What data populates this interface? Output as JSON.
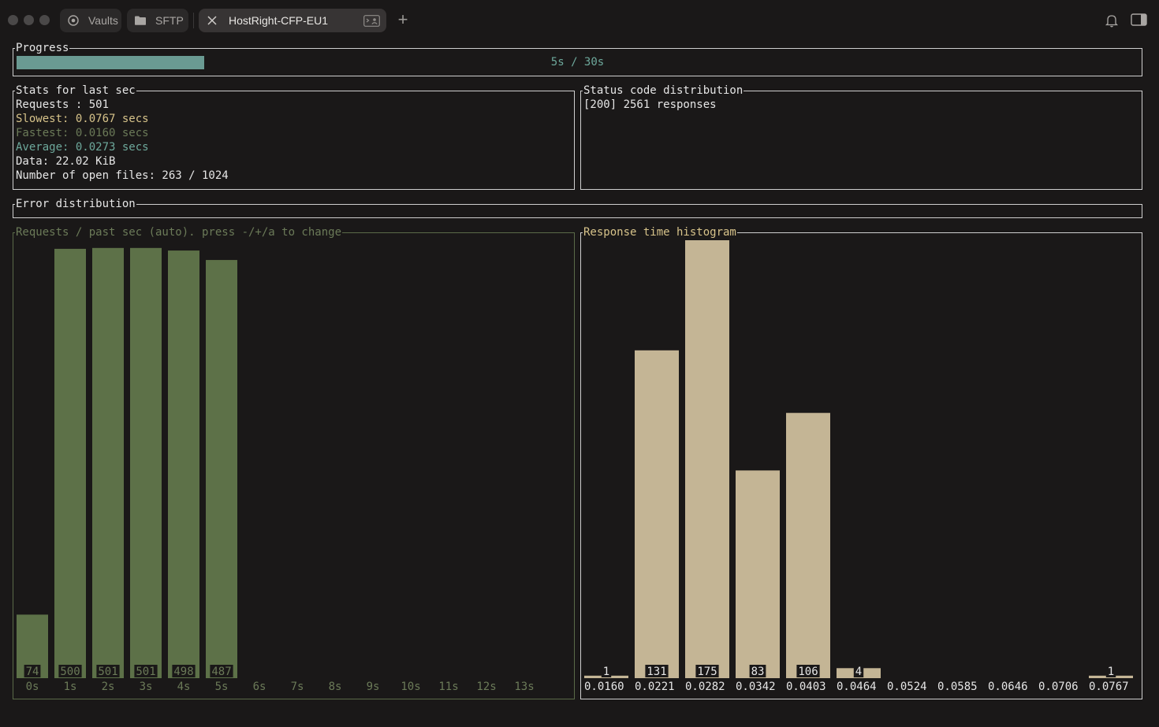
{
  "tabs": [
    {
      "label": "Vaults",
      "icon": "vault-icon"
    },
    {
      "label": "SFTP",
      "icon": "folder-icon"
    },
    {
      "label": "HostRight-CFP-EU1",
      "icon": "close-icon",
      "active": true
    }
  ],
  "progress": {
    "title": "Progress",
    "text": "5s / 30s",
    "fraction": 0.1667,
    "color": "#6a9a92"
  },
  "stats": {
    "title": "Stats for last sec",
    "requests": "Requests : 501",
    "slowest": "Slowest: 0.0767 secs",
    "fastest": "Fastest: 0.0160 secs",
    "average": "Average: 0.0273 secs",
    "data": "Data: 22.02 KiB",
    "open_files": "Number of open files: 263 / 1024",
    "colors": {
      "slowest": "#d7c38a",
      "fastest": "#6b7a58",
      "average": "#6da89b"
    }
  },
  "status": {
    "title": "Status code distribution",
    "line": "[200] 2561 responses"
  },
  "errors": {
    "title": "Error distribution"
  },
  "chart_data": [
    {
      "type": "bar",
      "title": "Requests / past sec (auto). press -/+/a to change",
      "categories": [
        "0s",
        "1s",
        "2s",
        "3s",
        "4s",
        "5s",
        "6s",
        "7s",
        "8s",
        "9s",
        "10s",
        "11s",
        "12s",
        "13s"
      ],
      "values": [
        74,
        500,
        501,
        501,
        498,
        487,
        null,
        null,
        null,
        null,
        null,
        null,
        null,
        null
      ],
      "value_labels": [
        "74",
        "500",
        "501",
        "501",
        "498",
        "487"
      ],
      "ylim": [
        0,
        510
      ],
      "color": "#5d7148",
      "label_color": "#6b7a58"
    },
    {
      "type": "bar",
      "title": "Response time histogram",
      "categories": [
        "0.0160",
        "0.0221",
        "0.0282",
        "0.0342",
        "0.0403",
        "0.0464",
        "0.0524",
        "0.0585",
        "0.0646",
        "0.0706",
        "0.0767"
      ],
      "values": [
        1,
        131,
        175,
        83,
        106,
        4,
        0,
        0,
        0,
        0,
        1
      ],
      "value_labels": [
        "1",
        "131",
        "175",
        "83",
        "106",
        "4",
        "",
        "",
        "",
        "",
        "1"
      ],
      "ylim": [
        0,
        175
      ],
      "color": "#c4b595",
      "label_color": "#e6e6e6"
    }
  ]
}
